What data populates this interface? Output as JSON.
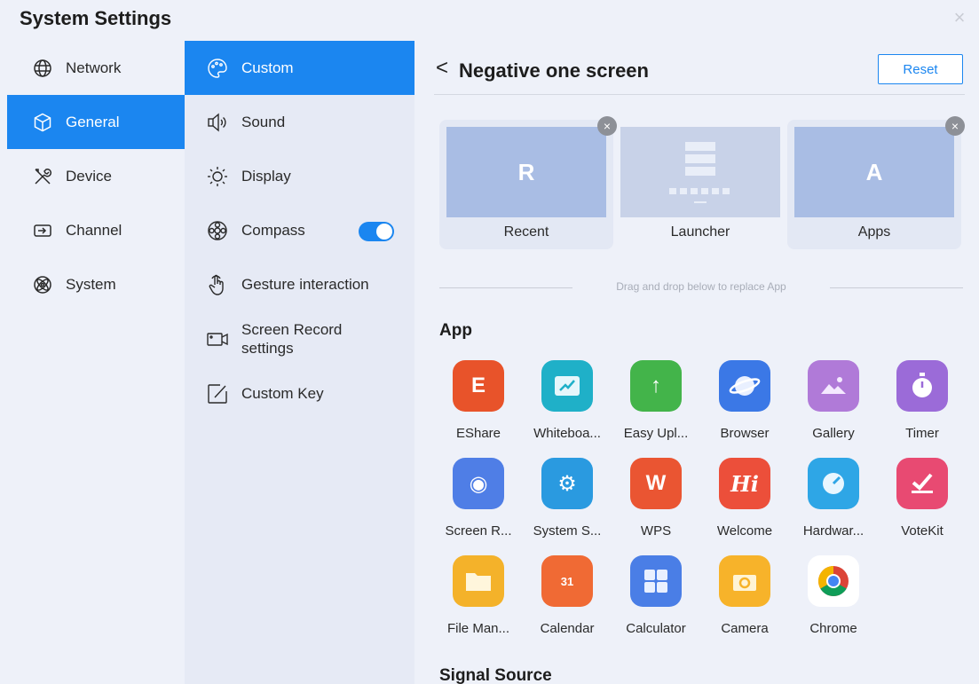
{
  "window": {
    "title": "System Settings",
    "close_glyph": "×"
  },
  "primary_nav": [
    {
      "label": "Network",
      "icon": "globe-icon",
      "active": false
    },
    {
      "label": "General",
      "icon": "cube-icon",
      "active": true
    },
    {
      "label": "Device",
      "icon": "tools-icon",
      "active": false
    },
    {
      "label": "Channel",
      "icon": "input-icon",
      "active": false
    },
    {
      "label": "System",
      "icon": "atom-icon",
      "active": false
    }
  ],
  "secondary_nav": [
    {
      "label": "Custom",
      "icon": "palette-icon",
      "active": true
    },
    {
      "label": "Sound",
      "icon": "speaker-icon",
      "active": false
    },
    {
      "label": "Display",
      "icon": "sun-icon",
      "active": false
    },
    {
      "label": "Compass",
      "icon": "compass-icon",
      "active": false,
      "toggle_on": true
    },
    {
      "label": "Gesture interaction",
      "icon": "hand-pointer-icon",
      "active": false
    },
    {
      "label_line1": "Screen Record",
      "label_line2": "settings",
      "icon": "video-camera-icon",
      "active": false
    },
    {
      "label": "Custom Key",
      "icon": "edit-icon",
      "active": false
    }
  ],
  "content": {
    "back_glyph": "<",
    "title": "Negative one screen",
    "reset_label": "Reset",
    "screens": [
      {
        "label": "Recent",
        "letter": "R",
        "removable": true
      },
      {
        "label": "Launcher",
        "letter": "",
        "removable": false
      },
      {
        "label": "Apps",
        "letter": "A",
        "removable": true
      }
    ],
    "remove_glyph": "×",
    "drag_hint": "Drag and drop below to replace App",
    "app_section": "App",
    "signal_section": "Signal Source",
    "apps": [
      {
        "name": "EShare",
        "glyph": "E",
        "color": "#e8532a"
      },
      {
        "name": "Whiteboa...",
        "glyph": "",
        "color": "#1fb0c8"
      },
      {
        "name": "Easy Upl...",
        "glyph": "↑",
        "color": "#43b44a"
      },
      {
        "name": "Browser",
        "glyph": "",
        "color": "#3b78e6"
      },
      {
        "name": "Gallery",
        "glyph": "",
        "color": "#b07ad8"
      },
      {
        "name": "Timer",
        "glyph": "",
        "color": "#9b6bd8"
      },
      {
        "name": "Screen R...",
        "glyph": "◉",
        "color": "#4f7ee6"
      },
      {
        "name": "System S...",
        "glyph": "⚙",
        "color": "#2a9ae0"
      },
      {
        "name": "WPS",
        "glyph": "W",
        "color": "#ea5532"
      },
      {
        "name": "Welcome",
        "glyph": "Hi",
        "color": "#ec4f3a"
      },
      {
        "name": "Hardwar...",
        "glyph": "",
        "color": "#2ea6e6"
      },
      {
        "name": "VoteKit",
        "glyph": "",
        "color": "#e84a72"
      },
      {
        "name": "File Man...",
        "glyph": "",
        "color": "#f4b22a"
      },
      {
        "name": "Calendar",
        "glyph": "31",
        "color": "#f06a34"
      },
      {
        "name": "Calculator",
        "glyph": "",
        "color": "#4a7ee6"
      },
      {
        "name": "Camera",
        "glyph": "",
        "color": "#f7b32a"
      },
      {
        "name": "Chrome",
        "glyph": "",
        "color": "#ffffff"
      }
    ]
  }
}
